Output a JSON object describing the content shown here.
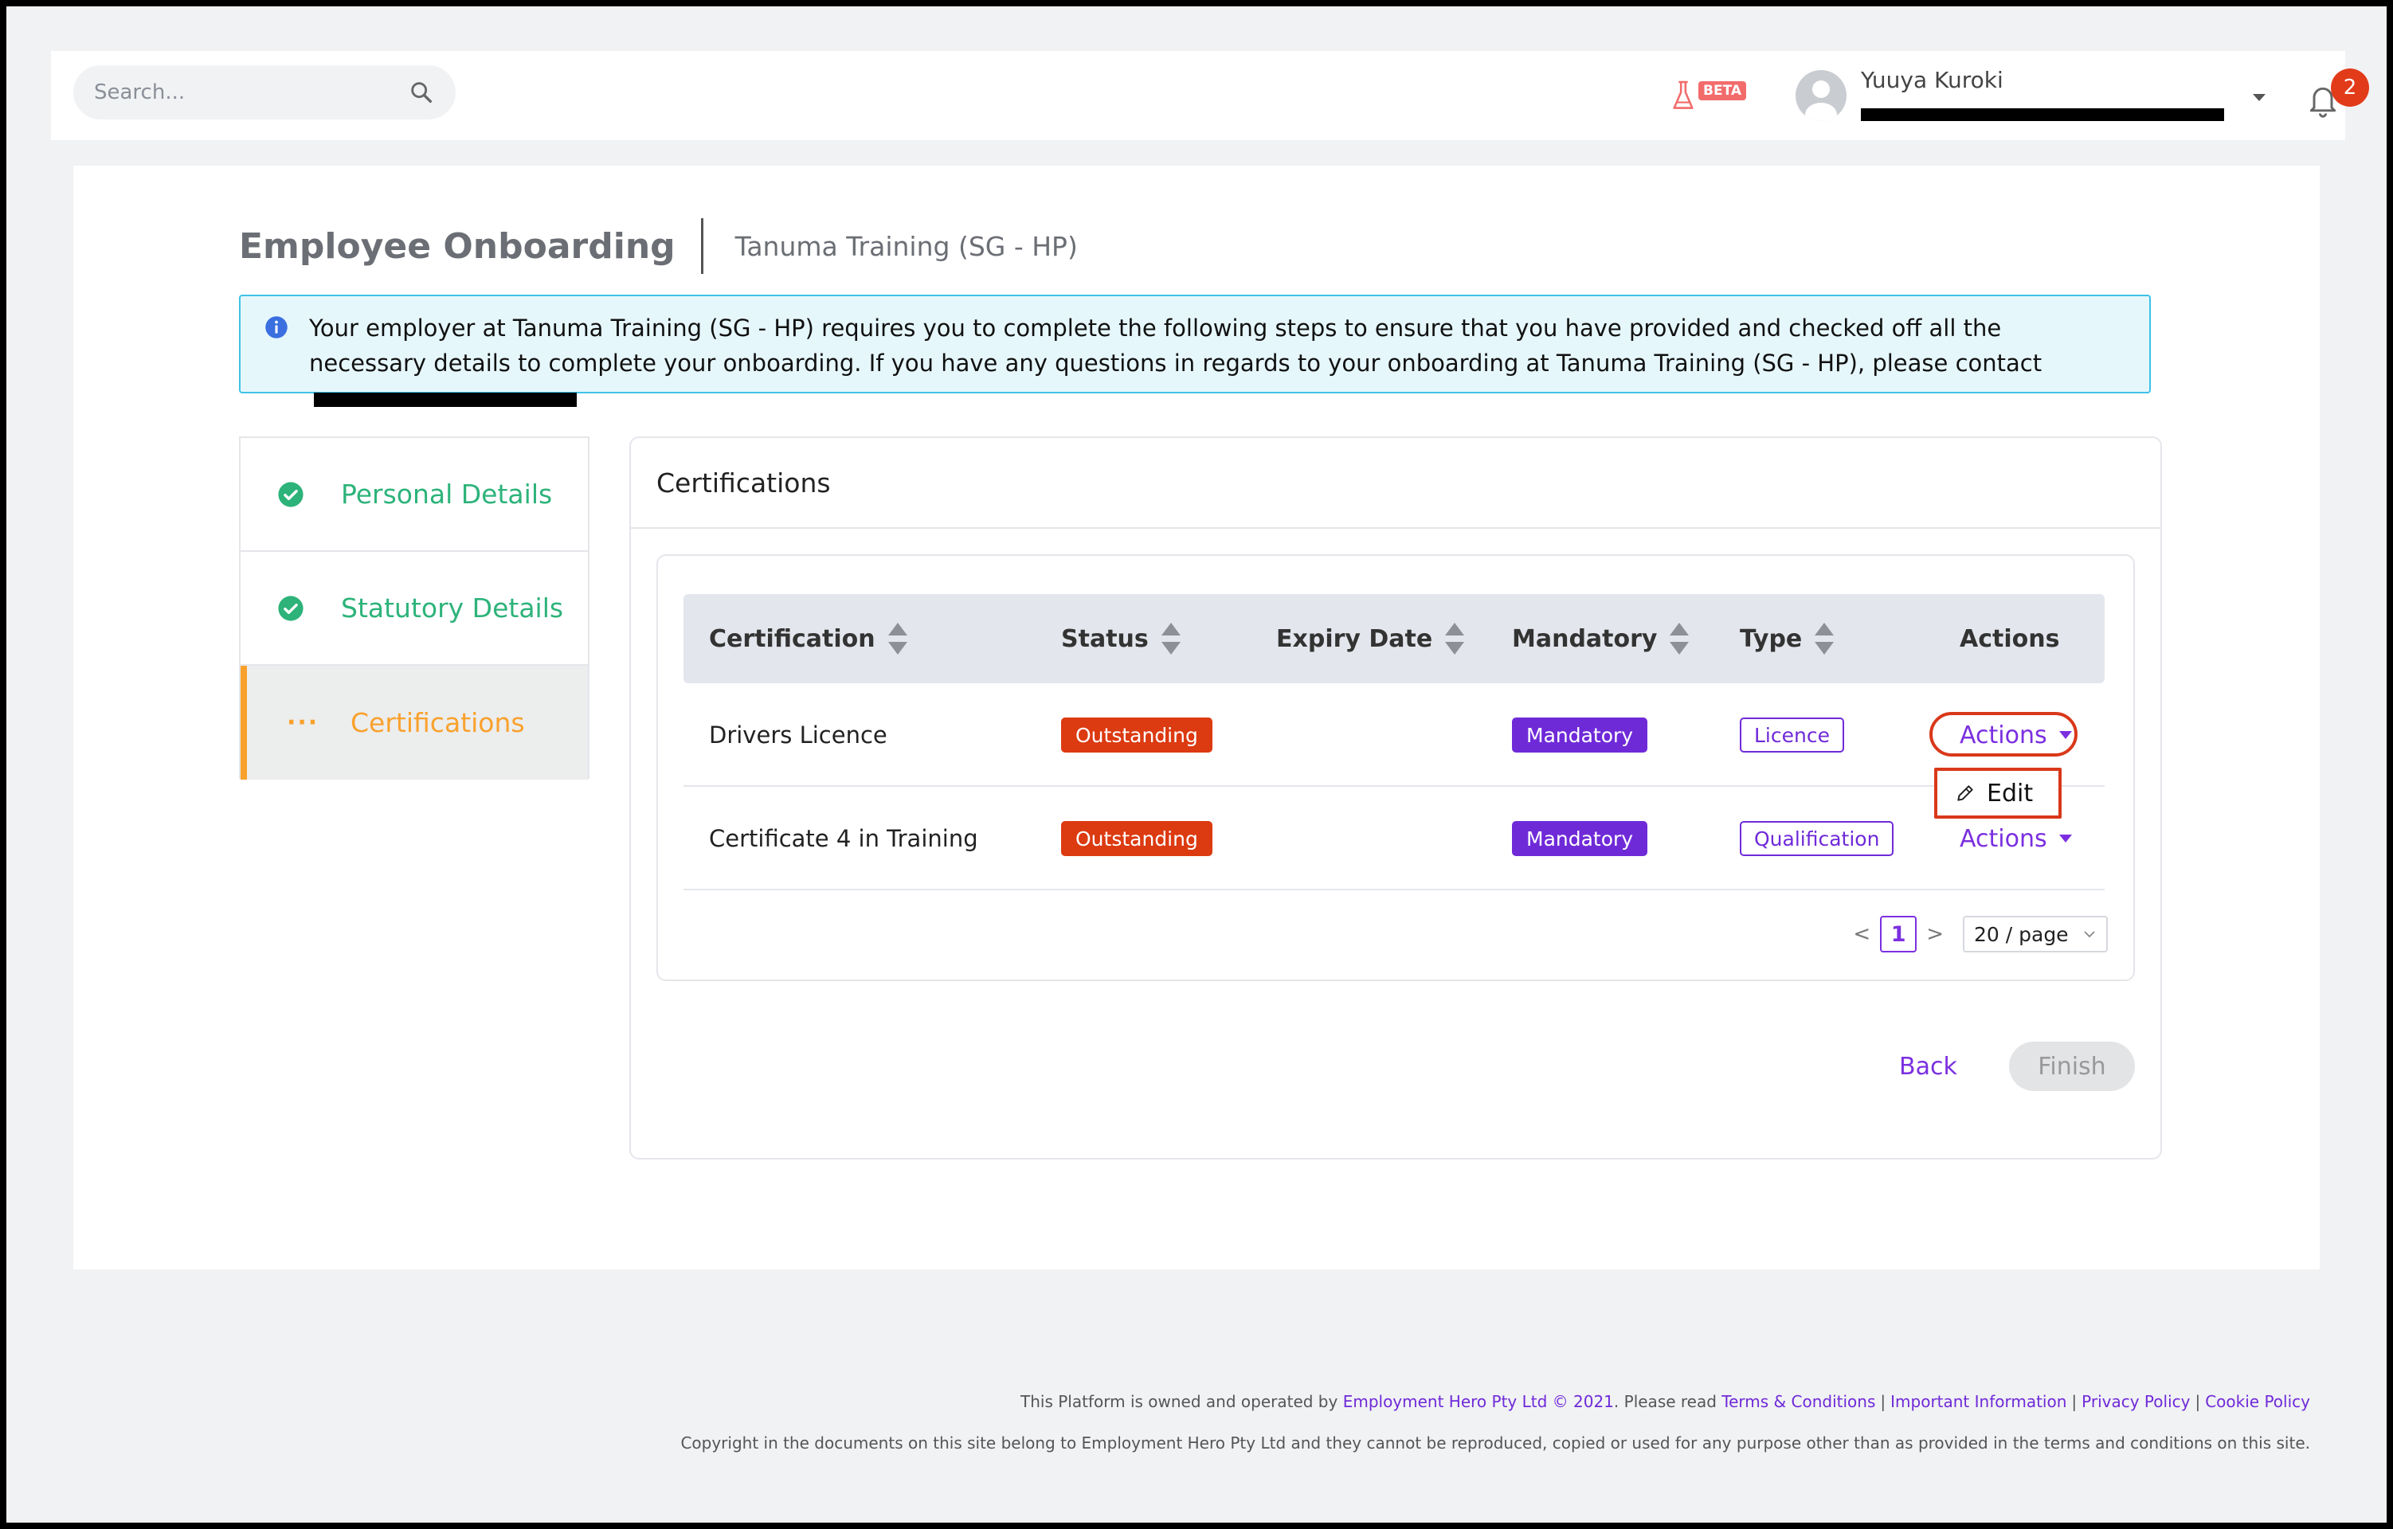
{
  "header": {
    "search_placeholder": "Search...",
    "beta_label": "BETA",
    "user_name": "Yuuya Kuroki",
    "notification_count": "2"
  },
  "page": {
    "title": "Employee Onboarding",
    "subtitle": "Tanuma Training (SG - HP)",
    "info_text": "Your employer at Tanuma Training (SG - HP) requires you to complete the following steps to ensure that you have provided and checked off all the necessary details to complete your onboarding. If you have any questions in regards to your onboarding at Tanuma Training (SG - HP), please contact"
  },
  "steps": [
    {
      "label": "Personal Details",
      "state": "done"
    },
    {
      "label": "Statutory Details",
      "state": "done"
    },
    {
      "label": "Certifications",
      "state": "active"
    }
  ],
  "certifications": {
    "panel_title": "Certifications",
    "columns": [
      "Certification",
      "Status",
      "Expiry Date",
      "Mandatory",
      "Type",
      "Actions"
    ],
    "rows": [
      {
        "certification": "Drivers Licence",
        "status": "Outstanding",
        "expiry": "",
        "mandatory": "Mandatory",
        "type": "Licence",
        "actions": "Actions"
      },
      {
        "certification": "Certificate 4 in Training",
        "status": "Outstanding",
        "expiry": "",
        "mandatory": "Mandatory",
        "type": "Qualification",
        "actions": "Actions"
      }
    ],
    "dropdown_edit": "Edit",
    "pagination": {
      "prev": "<",
      "page": "1",
      "next": ">",
      "page_size": "20 / page"
    },
    "back_label": "Back",
    "finish_label": "Finish"
  },
  "footer": {
    "line1_prefix": "This Platform is owned and operated by",
    "company_link": "Employment Hero Pty Ltd © 2021",
    "line1_mid": ". Please read",
    "links": [
      "Terms & Conditions",
      "Important Information",
      "Privacy Policy",
      "Cookie Policy"
    ],
    "line2": "Copyright in the documents on this site belong to Employment Hero Pty Ltd and they cannot be reproduced, copied or used for any purpose other than as provided in the terms and conditions on this site."
  },
  "colors": {
    "accent_purple": "#6f2ad8",
    "status_red": "#dc3a11",
    "success_green": "#2db37a",
    "active_orange": "#f9a12d"
  }
}
